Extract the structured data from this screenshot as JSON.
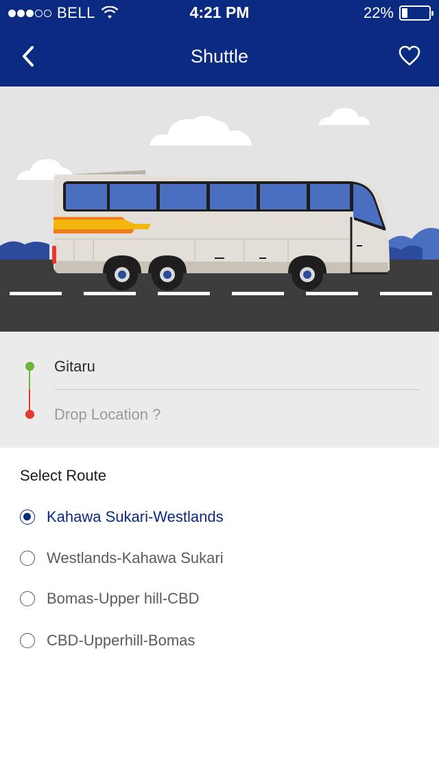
{
  "status_bar": {
    "carrier": "BELL",
    "time": "4:21 PM",
    "battery_percent_text": "22%",
    "battery_level": 0.22,
    "signal_bars_filled": 3,
    "signal_bars_total": 5
  },
  "header": {
    "title": "Shuttle",
    "back_icon": "chevron-left-icon",
    "favorite_icon": "heart-outline-icon"
  },
  "trip": {
    "pickup": "Gitaru",
    "drop_placeholder": "Drop Location ?",
    "drop_value": ""
  },
  "routes": {
    "heading": "Select Route",
    "items": [
      {
        "label": "Kahawa Sukari-Westlands",
        "selected": true
      },
      {
        "label": "Westlands-Kahawa Sukari",
        "selected": false
      },
      {
        "label": "Bomas-Upper hill-CBD",
        "selected": false
      },
      {
        "label": "CBD-Upperhill-Bomas",
        "selected": false
      }
    ]
  },
  "colors": {
    "primary": "#0b2a82",
    "pickup_dot": "#6db33f",
    "drop_dot": "#e5392e",
    "bus_window": "#4a6fc1",
    "bus_stripe_yellow": "#f2b70f",
    "bus_stripe_orange": "#ef7d1a",
    "road": "#3d3d3d"
  }
}
